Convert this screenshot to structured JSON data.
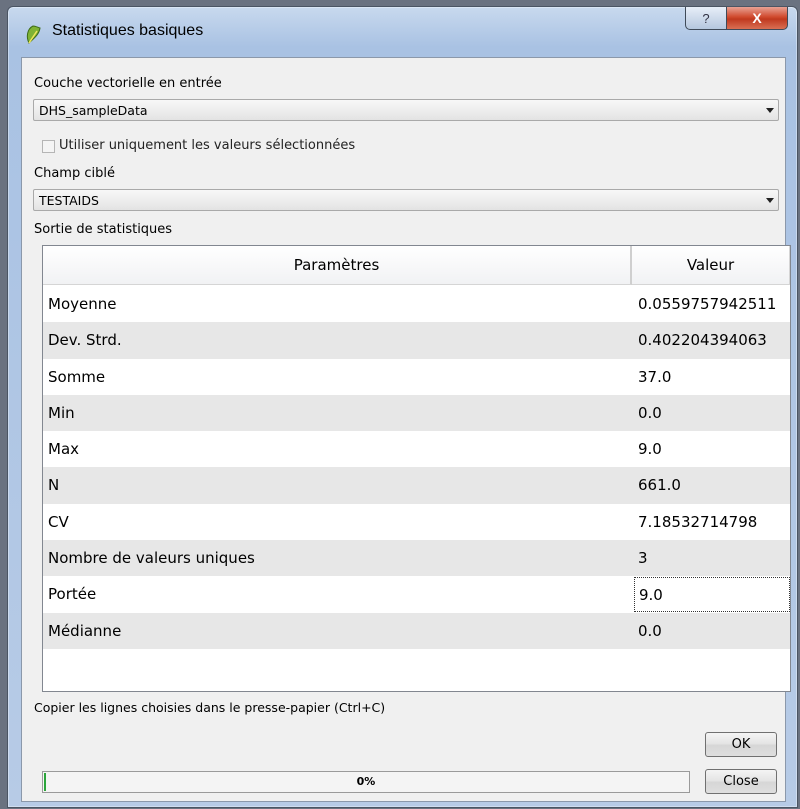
{
  "window": {
    "title": "Statistiques basiques",
    "help_glyph": "?",
    "close_glyph": "X"
  },
  "input_layer": {
    "label": "Couche vectorielle en entrée",
    "value": "DHS_sampleData"
  },
  "selected_only": {
    "label": "Utiliser uniquement les valeurs sélectionnées",
    "checked": false
  },
  "target_field": {
    "label": "Champ ciblé",
    "value": "TESTAIDS"
  },
  "output": {
    "label": "Sortie de statistiques",
    "columns": [
      "Paramètres",
      "Valeur"
    ],
    "rows": [
      {
        "param": "Moyenne",
        "value": "0.0559757942511"
      },
      {
        "param": "Dev. Strd.",
        "value": "0.402204394063"
      },
      {
        "param": "Somme",
        "value": "37.0"
      },
      {
        "param": "Min",
        "value": "0.0"
      },
      {
        "param": "Max",
        "value": "9.0"
      },
      {
        "param": "N",
        "value": "661.0"
      },
      {
        "param": "CV",
        "value": "7.18532714798"
      },
      {
        "param": "Nombre de valeurs uniques",
        "value": "3"
      },
      {
        "param": "Portée",
        "value": "9.0"
      },
      {
        "param": "Médianne",
        "value": "0.0"
      }
    ]
  },
  "copy_hint": "Copier les lignes choisies dans le presse-papier (Ctrl+C)",
  "progress": {
    "percent": 0,
    "label": "0%"
  },
  "buttons": {
    "ok": "OK",
    "close": "Close"
  },
  "colors": {
    "progress_fill": "#2ba53b",
    "close_button": "#c0391f",
    "row_alt": "#e7e7e7"
  }
}
